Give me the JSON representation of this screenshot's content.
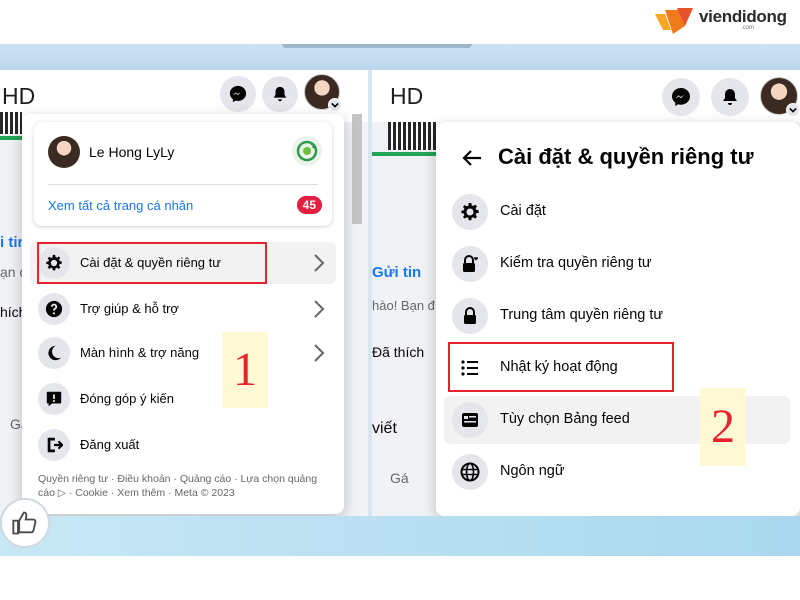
{
  "logo": {
    "name": "viendidong",
    "sub": ".com"
  },
  "left": {
    "header_text": "HD",
    "profile": {
      "name": "Le Hong LyLy",
      "view_all": "Xem tất cả trang cá nhân",
      "badge": "45"
    },
    "menu": [
      {
        "label": "Cài đặt & quyền riêng tư",
        "icon": "gear-icon",
        "chevron": true
      },
      {
        "label": "Trợ giúp & hỗ trợ",
        "icon": "question-icon",
        "chevron": true
      },
      {
        "label": "Màn hình & trợ năng",
        "icon": "moon-icon",
        "chevron": true
      },
      {
        "label": "Đóng góp ý kiến",
        "icon": "feedback-icon",
        "chevron": false
      },
      {
        "label": "Đăng xuất",
        "icon": "logout-icon",
        "chevron": false
      }
    ],
    "footer": "Quyền riêng tư · Điều khoản · Quảng cáo · Lựa chọn quảng cáo ▷ · Cookie · Xem thêm · Meta © 2023",
    "bg_texts": [
      "i tin",
      "ạn đ",
      "hích",
      "Gá"
    ],
    "step": "1"
  },
  "right": {
    "header_text": "HD",
    "menu_title": "Cài đặt & quyền riêng tư",
    "menu": [
      {
        "label": "Cài đặt",
        "icon": "gear-icon"
      },
      {
        "label": "Kiểm tra quyền riêng tư",
        "icon": "lock-heart-icon"
      },
      {
        "label": "Trung tâm quyền riêng tư",
        "icon": "lock-icon"
      },
      {
        "label": "Nhật ký hoạt động",
        "icon": "list-icon"
      },
      {
        "label": "Tùy chọn Bảng feed",
        "icon": "feed-icon"
      },
      {
        "label": "Ngôn ngữ",
        "icon": "globe-icon"
      }
    ],
    "bg_texts": [
      "Gửi tin",
      "hào! Bạn đ",
      "Đã thích",
      "viết",
      "Gá"
    ],
    "step": "2"
  },
  "colors": {
    "accent": "#1877f2",
    "highlight": "#e8232d",
    "badge": "#e41e3f"
  }
}
